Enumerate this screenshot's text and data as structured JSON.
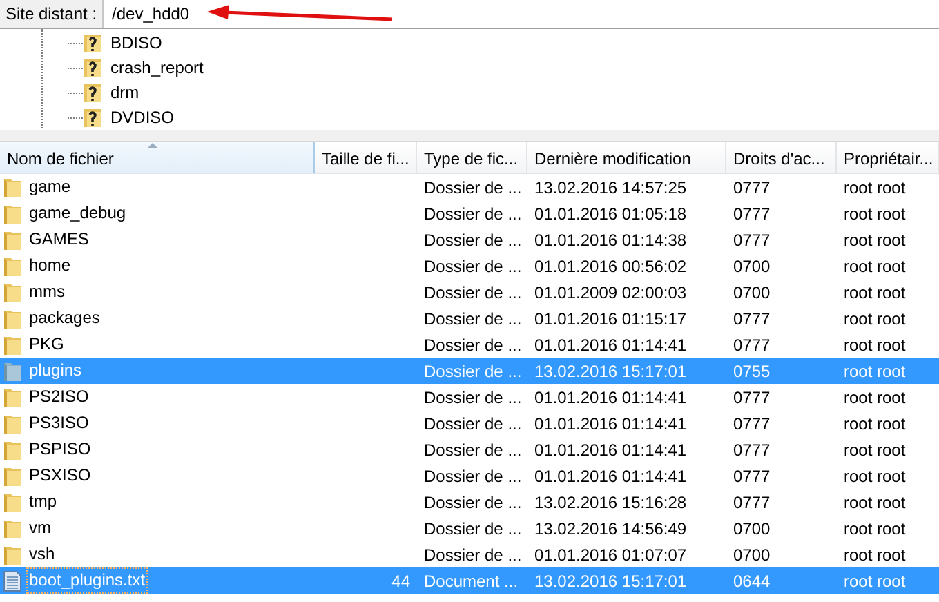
{
  "remote_site": {
    "label": "Site distant :",
    "value": "/dev_hdd0"
  },
  "tree": {
    "items": [
      {
        "label": "BDISO"
      },
      {
        "label": "crash_report"
      },
      {
        "label": "drm"
      },
      {
        "label": "DVDISO"
      }
    ]
  },
  "table": {
    "columns": [
      {
        "label": "Nom de fichier",
        "sorted": true
      },
      {
        "label": "Taille de fi...",
        "sorted": false
      },
      {
        "label": "Type de fic...",
        "sorted": false
      },
      {
        "label": "Dernière modification",
        "sorted": false
      },
      {
        "label": "Droits d'ac...",
        "sorted": false
      },
      {
        "label": "Propriétair...",
        "sorted": false
      }
    ],
    "rows": [
      {
        "kind": "folder",
        "selected": false,
        "cells": [
          "game",
          "",
          "Dossier de ...",
          "13.02.2016 14:57:25",
          "0777",
          "root root"
        ]
      },
      {
        "kind": "folder",
        "selected": false,
        "cells": [
          "game_debug",
          "",
          "Dossier de ...",
          "01.01.2016 01:05:18",
          "0777",
          "root root"
        ]
      },
      {
        "kind": "folder",
        "selected": false,
        "cells": [
          "GAMES",
          "",
          "Dossier de ...",
          "01.01.2016 01:14:38",
          "0777",
          "root root"
        ]
      },
      {
        "kind": "folder",
        "selected": false,
        "cells": [
          "home",
          "",
          "Dossier de ...",
          "01.01.2016 00:56:02",
          "0700",
          "root root"
        ]
      },
      {
        "kind": "folder",
        "selected": false,
        "cells": [
          "mms",
          "",
          "Dossier de ...",
          "01.01.2009 02:00:03",
          "0700",
          "root root"
        ]
      },
      {
        "kind": "folder",
        "selected": false,
        "cells": [
          "packages",
          "",
          "Dossier de ...",
          "01.01.2016 01:15:17",
          "0777",
          "root root"
        ]
      },
      {
        "kind": "folder",
        "selected": false,
        "cells": [
          "PKG",
          "",
          "Dossier de ...",
          "01.01.2016 01:14:41",
          "0777",
          "root root"
        ]
      },
      {
        "kind": "folder",
        "selected": true,
        "cells": [
          "plugins",
          "",
          "Dossier de ...",
          "13.02.2016 15:17:01",
          "0755",
          "root root"
        ]
      },
      {
        "kind": "folder",
        "selected": false,
        "cells": [
          "PS2ISO",
          "",
          "Dossier de ...",
          "01.01.2016 01:14:41",
          "0777",
          "root root"
        ]
      },
      {
        "kind": "folder",
        "selected": false,
        "cells": [
          "PS3ISO",
          "",
          "Dossier de ...",
          "01.01.2016 01:14:41",
          "0777",
          "root root"
        ]
      },
      {
        "kind": "folder",
        "selected": false,
        "cells": [
          "PSPISO",
          "",
          "Dossier de ...",
          "01.01.2016 01:14:41",
          "0777",
          "root root"
        ]
      },
      {
        "kind": "folder",
        "selected": false,
        "cells": [
          "PSXISO",
          "",
          "Dossier de ...",
          "01.01.2016 01:14:41",
          "0777",
          "root root"
        ]
      },
      {
        "kind": "folder",
        "selected": false,
        "cells": [
          "tmp",
          "",
          "Dossier de ...",
          "13.02.2016 15:16:28",
          "0777",
          "root root"
        ]
      },
      {
        "kind": "folder",
        "selected": false,
        "cells": [
          "vm",
          "",
          "Dossier de ...",
          "13.02.2016 14:56:49",
          "0700",
          "root root"
        ]
      },
      {
        "kind": "folder",
        "selected": false,
        "cells": [
          "vsh",
          "",
          "Dossier de ...",
          "01.01.2016 01:07:07",
          "0700",
          "root root"
        ]
      },
      {
        "kind": "file",
        "selected": true,
        "cells": [
          "boot_plugins.txt",
          "44",
          "Document ...",
          "13.02.2016 15:17:01",
          "0644",
          "root root"
        ]
      }
    ]
  }
}
